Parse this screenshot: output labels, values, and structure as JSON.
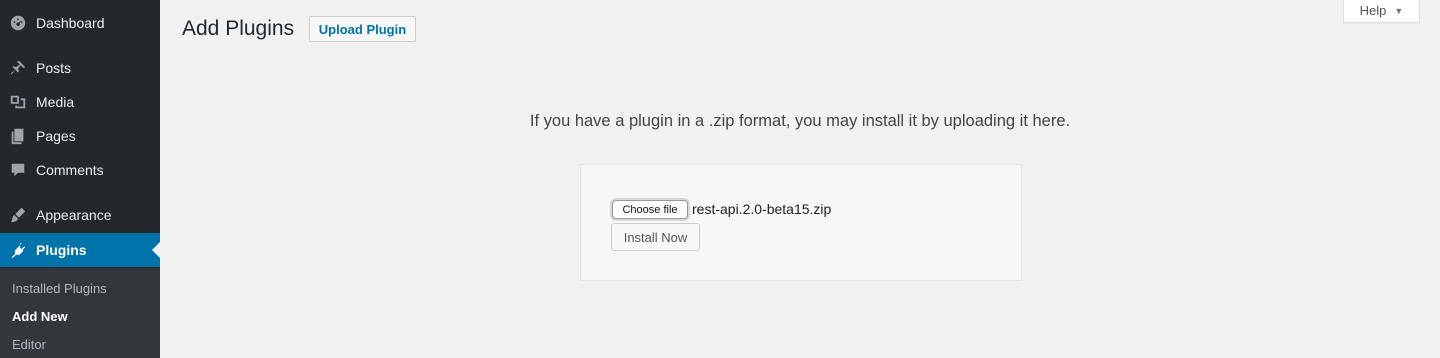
{
  "sidebar": {
    "items": [
      {
        "label": "Dashboard",
        "icon": "dashboard-icon"
      },
      {
        "label": "Posts",
        "icon": "pushpin-icon"
      },
      {
        "label": "Media",
        "icon": "media-icon"
      },
      {
        "label": "Pages",
        "icon": "pages-icon"
      },
      {
        "label": "Comments",
        "icon": "comment-icon"
      },
      {
        "label": "Appearance",
        "icon": "paintbrush-icon"
      },
      {
        "label": "Plugins",
        "icon": "plug-icon"
      }
    ],
    "submenu": [
      "Installed Plugins",
      "Add New",
      "Editor"
    ],
    "accent_color": "#0073aa"
  },
  "header": {
    "title": "Add Plugins",
    "upload_button": "Upload Plugin",
    "help": "Help"
  },
  "upload": {
    "description": "If you have a plugin in a .zip format, you may install it by uploading it here.",
    "choose_file": "Choose file",
    "file_name": "rest-api.2.0-beta15.zip",
    "install_button": "Install Now"
  }
}
